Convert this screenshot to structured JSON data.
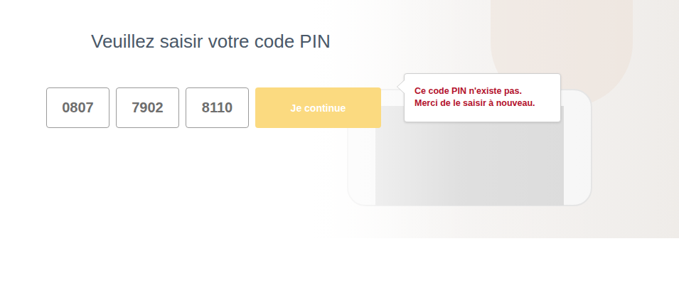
{
  "page": {
    "title": "Veuillez saisir votre code PIN"
  },
  "pin_fields": [
    {
      "value": "0807"
    },
    {
      "value": "7902"
    },
    {
      "value": "8110"
    }
  ],
  "submit_button": {
    "label": "Je continue",
    "disabled": true
  },
  "error_tooltip": {
    "lines": [
      "Ce code PIN n'existe pas.",
      "Merci de le saisir à nouveau."
    ]
  }
}
